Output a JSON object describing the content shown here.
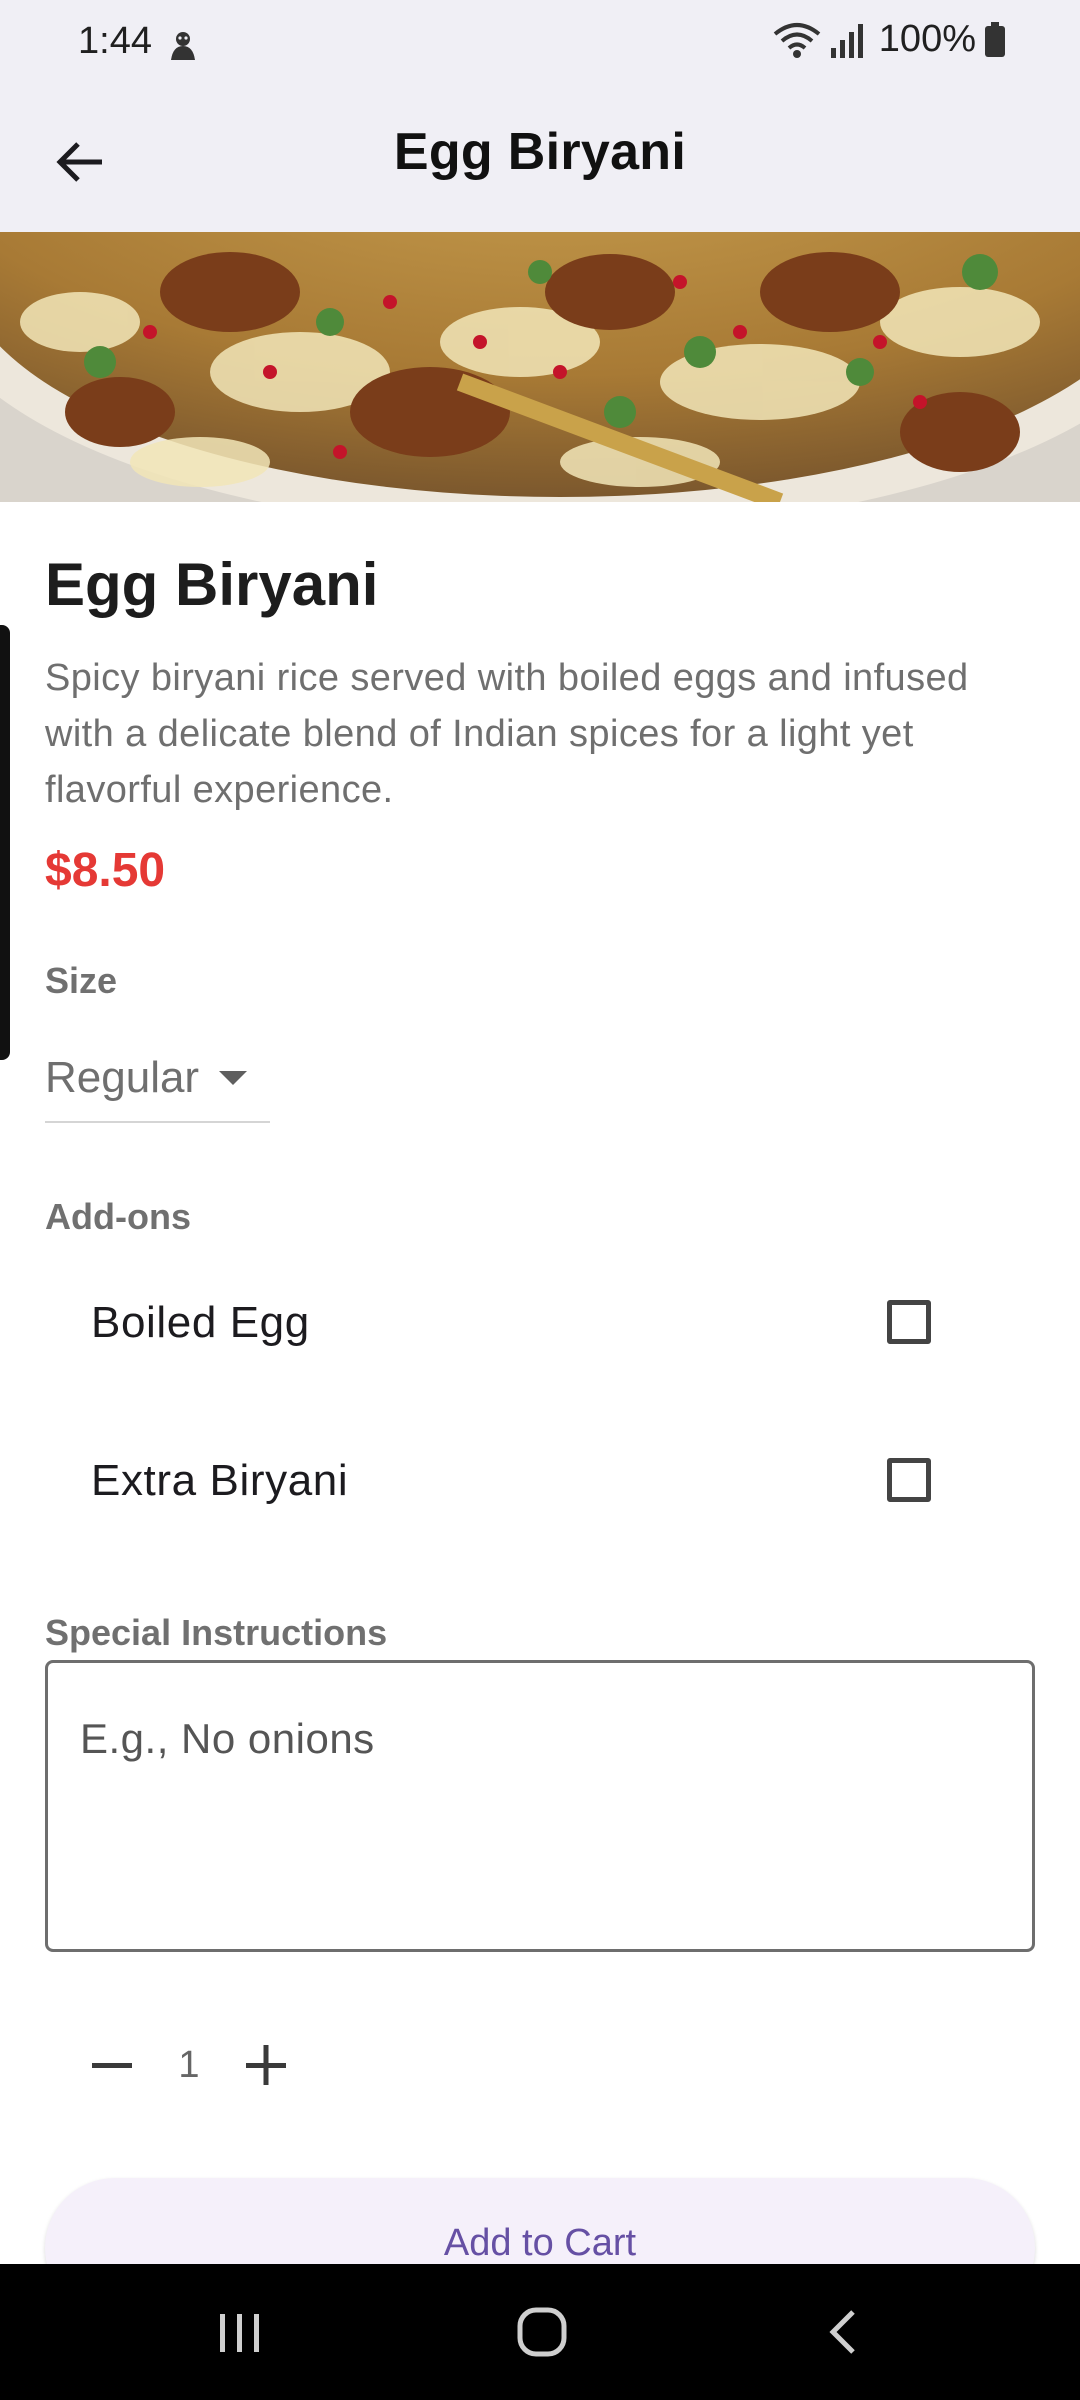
{
  "status_bar": {
    "time": "1:44",
    "battery": "100%"
  },
  "app_bar": {
    "title": "Egg Biryani"
  },
  "item": {
    "name": "Egg Biryani",
    "description": "Spicy biryani rice served with boiled eggs and infused with a delicate blend of Indian spices for a light yet flavorful experience.",
    "price": "$8.50",
    "price_color": "#e53935"
  },
  "size": {
    "label": "Size",
    "selected": "Regular"
  },
  "addons": {
    "label": "Add-ons",
    "items": [
      {
        "label": "Boiled Egg",
        "checked": false
      },
      {
        "label": "Extra Biryani",
        "checked": false
      }
    ]
  },
  "instructions": {
    "label": "Special Instructions",
    "placeholder": "E.g., No onions"
  },
  "quantity": {
    "value": "1"
  },
  "cart": {
    "button_label": "Add to Cart",
    "accent": "#6650a4"
  },
  "icons": {
    "back": "arrow-left-icon",
    "dropdown": "caret-down-icon",
    "minus": "minus-icon",
    "plus": "plus-icon",
    "nav_recents": "recents-icon",
    "nav_home": "home-icon",
    "nav_back": "back-chevron-icon"
  }
}
